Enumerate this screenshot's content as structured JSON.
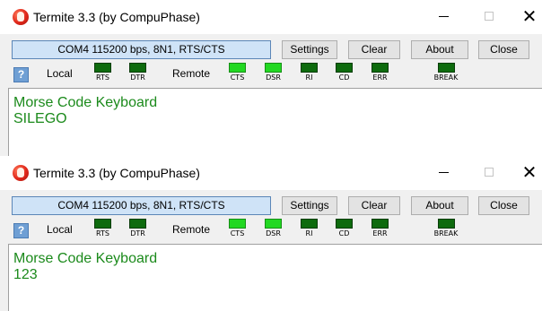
{
  "windows": [
    {
      "title": "Termite 3.3 (by CompuPhase)",
      "port_status": "COM4 115200 bps, 8N1, RTS/CTS",
      "buttons": {
        "settings": "Settings",
        "clear": "Clear",
        "about": "About",
        "close": "Close"
      },
      "help": "?",
      "local_label": "Local",
      "remote_label": "Remote",
      "local_lamps": [
        {
          "label": "RTS",
          "state": "off"
        },
        {
          "label": "DTR",
          "state": "off"
        }
      ],
      "remote_lamps": [
        {
          "label": "CTS",
          "state": "on"
        },
        {
          "label": "DSR",
          "state": "on"
        },
        {
          "label": "RI",
          "state": "off"
        },
        {
          "label": "CD",
          "state": "off"
        },
        {
          "label": "ERR",
          "state": "off"
        }
      ],
      "break_lamp": {
        "label": "BREAK",
        "state": "off"
      },
      "terminal_lines": [
        "Morse Code Keyboard",
        "SILEGO"
      ]
    },
    {
      "title": "Termite 3.3 (by CompuPhase)",
      "port_status": "COM4 115200 bps, 8N1, RTS/CTS",
      "buttons": {
        "settings": "Settings",
        "clear": "Clear",
        "about": "About",
        "close": "Close"
      },
      "help": "?",
      "local_label": "Local",
      "remote_label": "Remote",
      "local_lamps": [
        {
          "label": "RTS",
          "state": "off"
        },
        {
          "label": "DTR",
          "state": "off"
        }
      ],
      "remote_lamps": [
        {
          "label": "CTS",
          "state": "on"
        },
        {
          "label": "DSR",
          "state": "on"
        },
        {
          "label": "RI",
          "state": "off"
        },
        {
          "label": "CD",
          "state": "off"
        },
        {
          "label": "ERR",
          "state": "off"
        }
      ],
      "break_lamp": {
        "label": "BREAK",
        "state": "off"
      },
      "terminal_lines": [
        "Morse Code Keyboard",
        "123"
      ]
    }
  ],
  "icons": {
    "app": "termite-app-icon",
    "minimize": "minimize-icon",
    "maximize": "maximize-icon",
    "close": "close-icon",
    "help": "help-icon"
  },
  "colors": {
    "port_field_bg": "#cfe3f7",
    "lamp_on": "#22d822",
    "lamp_off": "#0e6b0e",
    "terminal_text": "#1b8a1b",
    "help_button": "#6f9fd4"
  }
}
